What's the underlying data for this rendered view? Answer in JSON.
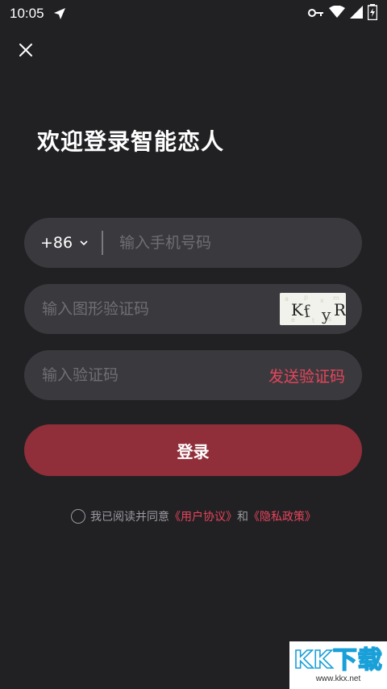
{
  "status_bar": {
    "time": "10:05",
    "icons": [
      "navigation-icon",
      "key-icon",
      "wifi-icon",
      "signal-icon",
      "battery-charging-icon"
    ]
  },
  "header": {
    "close_icon": "close-icon",
    "title": "欢迎登录智能恋人"
  },
  "form": {
    "country_code": "+86",
    "phone_placeholder": "输入手机号码",
    "captcha_placeholder": "输入图形验证码",
    "captcha_text": "KfyR",
    "code_placeholder": "输入验证码",
    "send_code_label": "发送验证码",
    "login_label": "登录"
  },
  "agreement": {
    "prefix": "我已阅读并同意",
    "user_agreement": "《用户协议》",
    "conjunction": "和",
    "privacy_policy": "《隐私政策》"
  },
  "watermark": {
    "main": "KK下载",
    "sub": "www.kkx.net"
  },
  "colors": {
    "background": "#212124",
    "field": "#3a3a3e",
    "accent": "#e8445b",
    "button": "#902f3a"
  }
}
